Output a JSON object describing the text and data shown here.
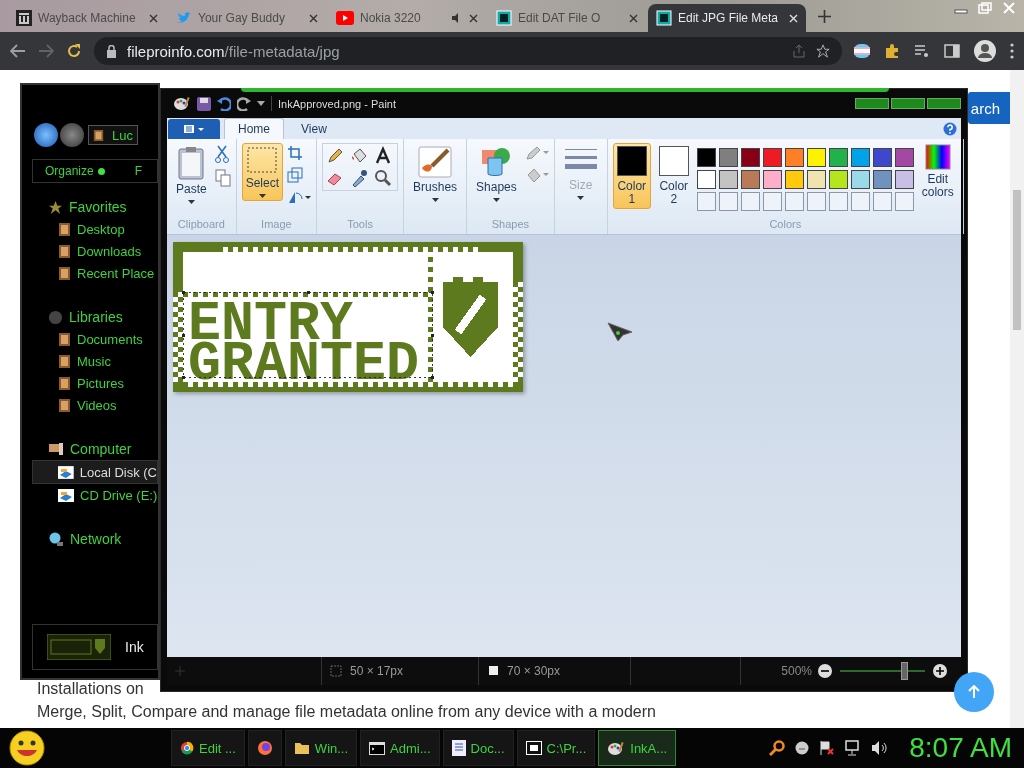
{
  "browser": {
    "tabs": [
      {
        "title": "Wayback Machine",
        "kind": "archive",
        "audio": false,
        "selected": false
      },
      {
        "title": "Your Gay Buddy",
        "kind": "bird",
        "audio": false,
        "selected": false
      },
      {
        "title": "Nokia 3220",
        "kind": "video",
        "audio": true,
        "selected": false
      },
      {
        "title": "Edit DAT File O",
        "kind": "file",
        "audio": false,
        "selected": false
      },
      {
        "title": "Edit JPG File Meta",
        "kind": "file",
        "audio": false,
        "selected": true
      }
    ],
    "address": {
      "domain": "fileproinfo.com",
      "path": "/file-metadata/jpg"
    }
  },
  "page": {
    "search_button": "arch",
    "lines": [
      "Installations on",
      "Merge, Split, Compare and manage file metadata online from any device with a modern"
    ]
  },
  "explorer": {
    "address": "Luc",
    "toolbar": [
      "Organize",
      "F"
    ],
    "nav": [
      {
        "label": "Favorites",
        "kind": "star",
        "children": [
          {
            "label": "Desktop",
            "kind": "folder",
            "selected": false
          },
          {
            "label": "Downloads",
            "kind": "folder",
            "selected": false
          },
          {
            "label": "Recent Place",
            "kind": "folder",
            "selected": false
          }
        ]
      },
      {
        "label": "Libraries",
        "kind": "disc",
        "children": [
          {
            "label": "Documents",
            "kind": "folder",
            "selected": false
          },
          {
            "label": "Music",
            "kind": "folder",
            "selected": false
          },
          {
            "label": "Pictures",
            "kind": "folder",
            "selected": false
          },
          {
            "label": "Videos",
            "kind": "folder",
            "selected": false
          }
        ]
      },
      {
        "label": "Computer",
        "kind": "computer",
        "children": [
          {
            "label": "Local Disk (C",
            "kind": "drive",
            "selected": true
          },
          {
            "label": "CD Drive (E:)",
            "kind": "drive",
            "selected": false
          }
        ]
      },
      {
        "label": "Network",
        "kind": "globe"
      }
    ],
    "preview_label": "Ink"
  },
  "paint": {
    "title": "InkApproved.png - Paint",
    "tabs": [
      {
        "label": "Home",
        "selected": true
      },
      {
        "label": "View",
        "selected": false
      }
    ],
    "groups": [
      {
        "label": "Clipboard",
        "kind": "clipboard",
        "buttons": [
          {
            "label": "Paste",
            "selected": false,
            "disabled": false
          }
        ]
      },
      {
        "label": "Image",
        "kind": "image",
        "buttons": [
          {
            "label": "Select",
            "selected": true,
            "disabled": false
          }
        ]
      },
      {
        "label": "Tools",
        "kind": "tools"
      },
      {
        "kind": "brushes",
        "buttons": [
          {
            "label": "Brushes",
            "selected": false,
            "disabled": false
          }
        ]
      },
      {
        "label": "Shapes",
        "kind": "shapes",
        "buttons": [
          {
            "label": "Shapes",
            "selected": false,
            "disabled": false
          }
        ]
      },
      {
        "kind": "size",
        "buttons": [
          {
            "label": "Size",
            "selected": false,
            "disabled": true
          }
        ]
      },
      {
        "label": "Colors",
        "kind": "colors"
      }
    ],
    "color_slots": [
      {
        "label": "Color 1",
        "color": "#000000",
        "selected": true
      },
      {
        "label": "Color 2",
        "color": "#ffffff",
        "selected": false
      }
    ],
    "palette": [
      {
        "color": "#000000"
      },
      {
        "color": "#7f7f7f"
      },
      {
        "color": "#880015"
      },
      {
        "color": "#ed1c24"
      },
      {
        "color": "#ff7f27"
      },
      {
        "color": "#fff200"
      },
      {
        "color": "#22b14c"
      },
      {
        "color": "#00a2e8"
      },
      {
        "color": "#3f48cc"
      },
      {
        "color": "#a349a4"
      },
      {
        "color": "#ffffff"
      },
      {
        "color": "#c3c3c3"
      },
      {
        "color": "#b97a57"
      },
      {
        "color": "#ffaec9"
      },
      {
        "color": "#ffc90e"
      },
      {
        "color": "#efe4b0"
      },
      {
        "color": "#b5e61d"
      },
      {
        "color": "#99d9ea"
      },
      {
        "color": "#7092be"
      },
      {
        "color": "#c8bfe7"
      }
    ],
    "edit_colors": "Edit colors",
    "image_text": [
      "ENTRY",
      "GRANTED"
    ],
    "status": {
      "selection_size": "50 × 17px",
      "image_size": "70 × 30px",
      "zoom": "500%",
      "zoom_slider": {
        "level": 0.75
      }
    }
  },
  "taskbar": {
    "items": [
      {
        "label": "Edit ...",
        "kind": "chrome",
        "selected": false
      },
      {
        "kind": "firefox",
        "selected": false
      },
      {
        "label": "Win...",
        "kind": "folder",
        "selected": false
      },
      {
        "label": "Admi...",
        "kind": "console",
        "selected": false
      },
      {
        "label": "Doc...",
        "kind": "doc",
        "selected": false
      },
      {
        "label": "C:\\Pr...",
        "kind": "zip",
        "selected": false
      },
      {
        "label": "InkA...",
        "kind": "paint",
        "selected": true
      }
    ],
    "clock": "8:07 AM"
  }
}
